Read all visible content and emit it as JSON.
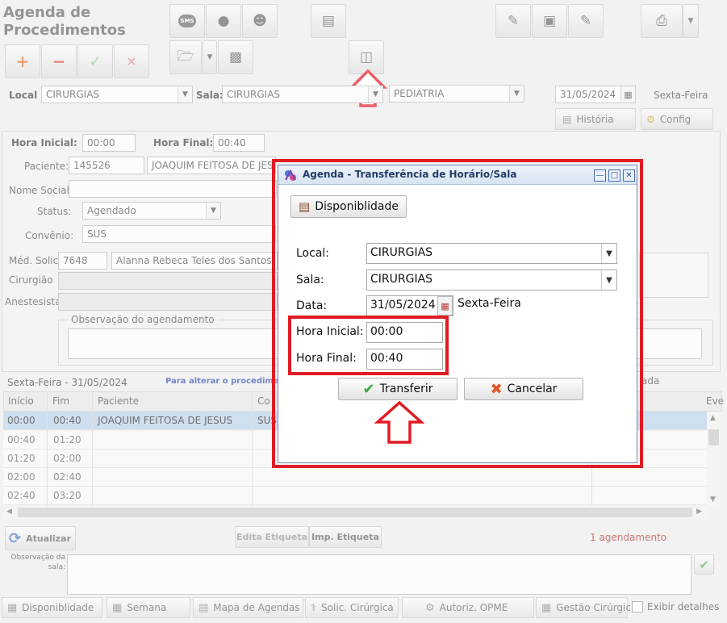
{
  "page": {
    "title_line1": "Agenda de",
    "title_line2": "Procedimentos"
  },
  "toolbar": {
    "add": "+",
    "remove": "−",
    "confirm": "✓",
    "cancel": "✕",
    "sms": "SMS"
  },
  "filters": {
    "local_label": "Local",
    "local_value": "CIRURGIAS",
    "sala_label": "Sala:",
    "sala_value": "CIRURGIAS",
    "especialidade_value": "PEDIATRIA",
    "date_value": "31/05/2024",
    "weekday": "Sexta-Feira",
    "historia_label": "História",
    "config_label": "Config"
  },
  "form": {
    "hora_inicial_label": "Hora Inicial:",
    "hora_inicial_value": "00:00",
    "hora_final_label": "Hora Final:",
    "hora_final_value": "00:40",
    "paciente_label": "Paciente:",
    "paciente_id": "145526",
    "paciente_nome": "JOAQUIM  FEITOSA DE JESUS",
    "nome_social_label": "Nome Social:",
    "status_label": "Status:",
    "status_value": "Agendado",
    "convenio_label": "Convênio:",
    "convenio_value": "SUS",
    "med_solic_label": "Méd. Solic.",
    "med_solic_id": "7648",
    "med_solic_nome": "Alanna Rebeca Teles dos Santos",
    "cirurgiao_label": "Cirurgião",
    "anestesista_label": "Anestesista",
    "observacao_label": "Observação do agendamento"
  },
  "grid": {
    "date_header": "Sexta-Feira - 31/05/2024",
    "hint": "Para alterar o procedime",
    "right_fragment": "ada",
    "columns": [
      "Início",
      "Fim",
      "Paciente",
      "Co",
      "Eve"
    ],
    "rows": [
      {
        "inicio": "00:00",
        "fim": "00:40",
        "paciente": "JOAQUIM FEITOSA DE JESUS",
        "conv": "SUS"
      },
      {
        "inicio": "00:40",
        "fim": "01:20",
        "paciente": "",
        "conv": ""
      },
      {
        "inicio": "01:20",
        "fim": "02:00",
        "paciente": "",
        "conv": ""
      },
      {
        "inicio": "02:00",
        "fim": "02:40",
        "paciente": "",
        "conv": ""
      },
      {
        "inicio": "02:40",
        "fim": "03:20",
        "paciente": "",
        "conv": ""
      }
    ]
  },
  "actions": {
    "atualizar": "Atualizar",
    "edita_etiqueta": "Edita Etiqueta",
    "imp_etiqueta": "Imp. Etiqueta",
    "count": "1 agendamento",
    "obs_sala_label_1": "Observação da",
    "obs_sala_label_2": "sala:"
  },
  "bottom_bar": {
    "disponibilidade": "Disponiblidade",
    "semana": "Semana",
    "mapa": "Mapa de Agendas",
    "solic": "Solic. Cirúrgica",
    "autoriz": "Autoriz. OPME",
    "gestao": "Gestão Cirúrgic",
    "exibir": "Exibir detalhes"
  },
  "dialog": {
    "title": "Agenda - Transferência de Horário/Sala",
    "disponibilidade_button": "Disponiblidade",
    "local_label": "Local:",
    "local_value": "CIRURGIAS",
    "sala_label": "Sala:",
    "sala_value": "CIRURGIAS",
    "data_label": "Data:",
    "data_value": "31/05/2024",
    "weekday": "Sexta-Feira",
    "hora_inicial_label": "Hora Inicial:",
    "hora_inicial_value": "00:00",
    "hora_final_label": "Hora Final:",
    "hora_final_value": "00:40",
    "transferir_button": "Transferir",
    "cancelar_button": "Cancelar"
  },
  "colors": {
    "highlight": "#e01b24",
    "dialog_title": "#233b66",
    "selected_row": "#b9d1ea"
  }
}
